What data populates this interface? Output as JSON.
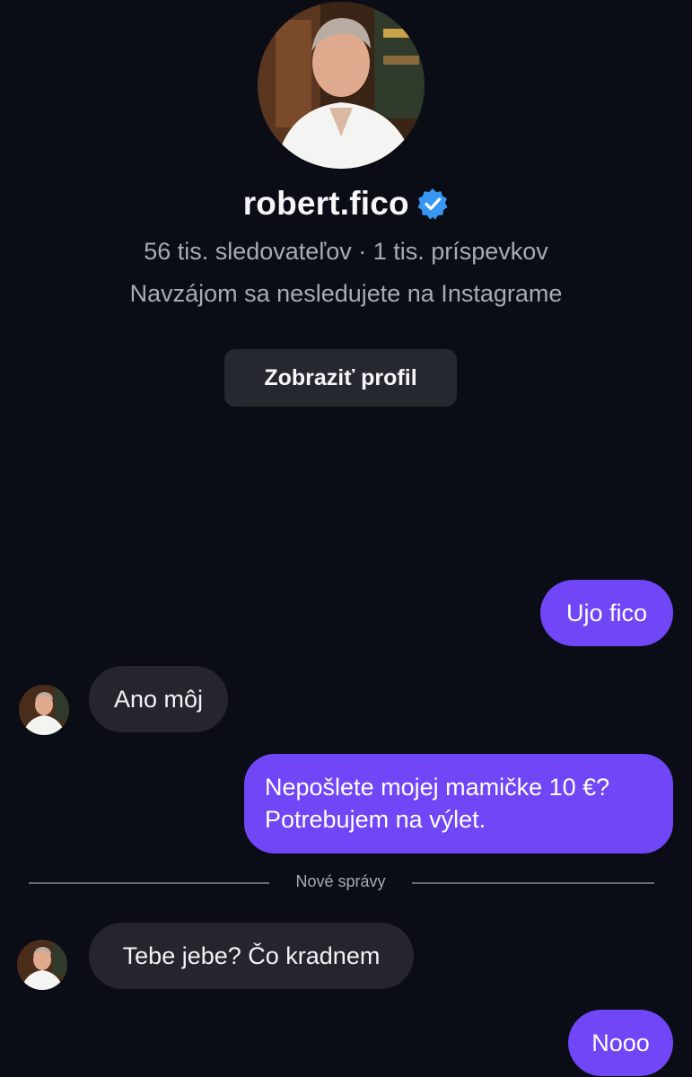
{
  "profile": {
    "username": "robert.fico",
    "verified_icon": "verified-badge-icon",
    "stats": "56 tis. sledovateľov · 1 tis. príspevkov",
    "mutual": "Navzájom sa nesledujete na Instagrame",
    "view_profile_label": "Zobraziť profil"
  },
  "messages": [
    {
      "direction": "outgoing",
      "lines": [
        "Ujo fico"
      ]
    },
    {
      "direction": "incoming",
      "lines": [
        "Ano môj"
      ]
    },
    {
      "direction": "outgoing",
      "lines": [
        "Nepošlete mojej mamičke 10 €?",
        "Potrebujem na výlet."
      ]
    },
    {
      "direction": "incoming",
      "lines": [
        "Tebe jebe? Čo kradnem"
      ]
    },
    {
      "direction": "outgoing",
      "lines": [
        "Nooo"
      ]
    }
  ],
  "divider": {
    "label": "Nové správy"
  },
  "colors": {
    "background": "#0b0d16",
    "outgoing_bubble": "#7046f6",
    "incoming_bubble": "#25262d",
    "verified": "#3897f0",
    "button": "#262830"
  }
}
